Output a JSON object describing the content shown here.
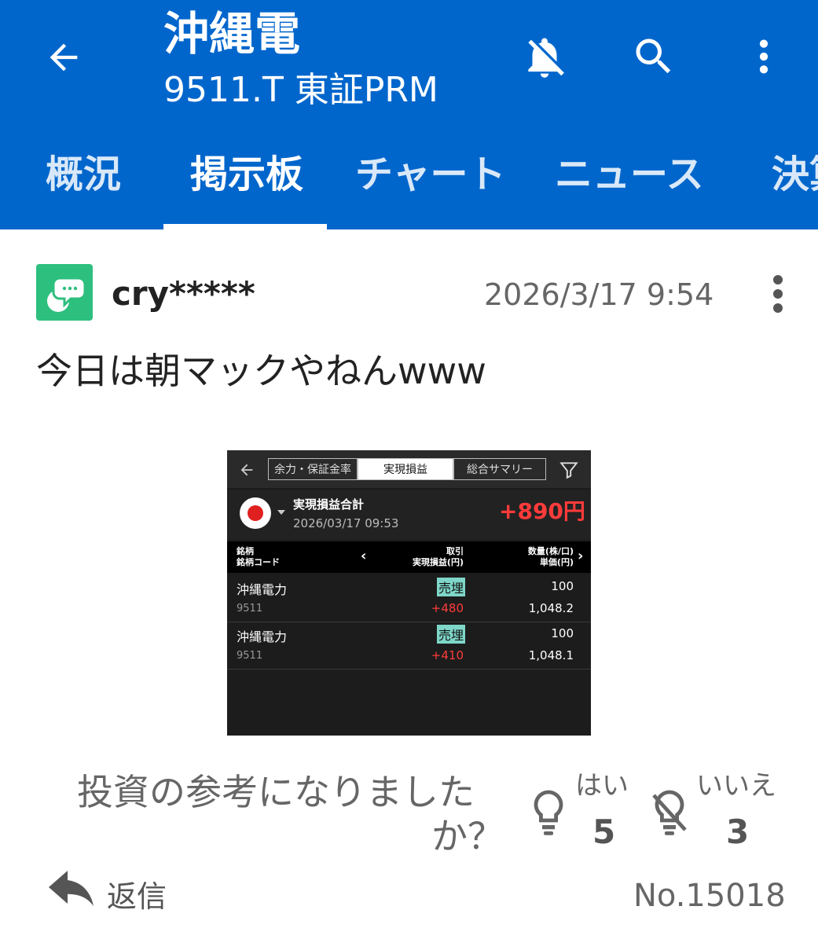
{
  "header": {
    "title": "沖縄電",
    "subtitle": "9511.T 東証PRM",
    "icons": [
      "back-arrow-icon",
      "bell-off-icon",
      "search-icon",
      "more-vertical-icon"
    ],
    "tabs": [
      {
        "label": "概況",
        "active": false
      },
      {
        "label": "掲示板",
        "active": true
      },
      {
        "label": "チャート",
        "active": false
      },
      {
        "label": "ニュース",
        "active": false
      },
      {
        "label": "決算",
        "active": false
      }
    ],
    "colors": {
      "bar": "#0066cc",
      "text": "#ffffff"
    }
  },
  "post": {
    "username": "cry*****",
    "timestamp": "2026/3/17 9:54",
    "body": "今日は朝マックやねんwww",
    "avatar_color": "#2dbf7e",
    "number": "No.15018"
  },
  "screenshot": {
    "tabs": [
      "余力・保証金率",
      "実現損益",
      "総合サマリー"
    ],
    "summary_title": "実現損益合計",
    "summary_date": "2026/03/17  09:53",
    "summary_total": "+890円",
    "col1": [
      "銘柄",
      "銘柄コード"
    ],
    "col2": [
      "取引",
      "実現損益(円)"
    ],
    "col3": [
      "数量(株/口)",
      "単価(円)"
    ],
    "rows": [
      {
        "name": "沖縄電力",
        "code": "9511",
        "trade": "売埋",
        "pnl": "+480",
        "qty": "100",
        "price": "1,048.2"
      },
      {
        "name": "沖縄電力",
        "code": "9511",
        "trade": "売埋",
        "pnl": "+410",
        "qty": "100",
        "price": "1,048.1"
      }
    ]
  },
  "feedback": {
    "question_line1": "投資の参考になりました",
    "question_line2": "か？",
    "yes_label": "はい",
    "yes_count": "5",
    "no_label": "いいえ",
    "no_count": "3"
  },
  "reply": {
    "label": "返信"
  }
}
